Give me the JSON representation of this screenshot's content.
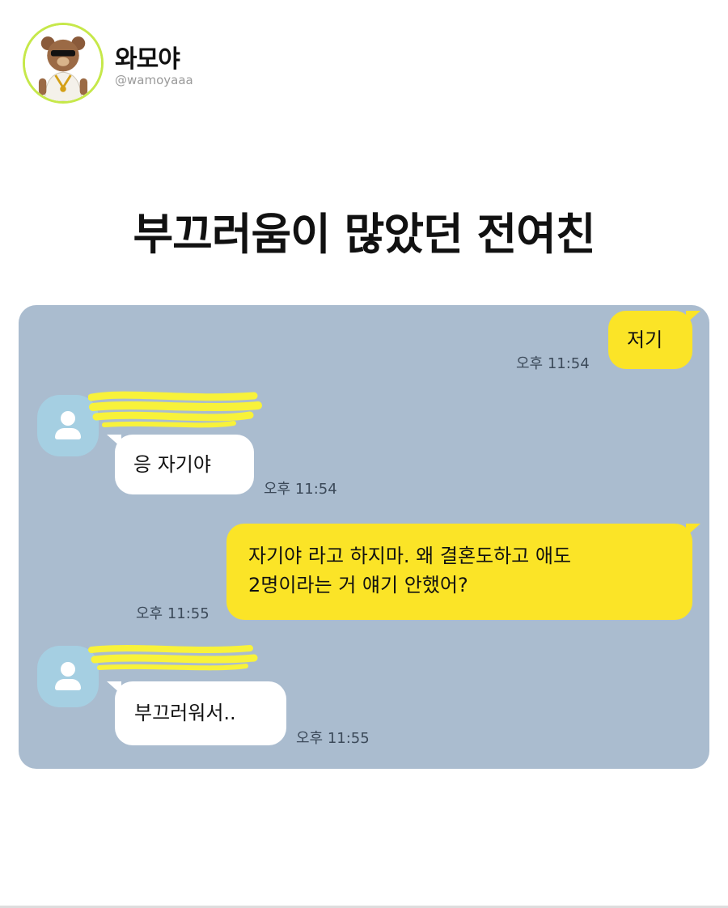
{
  "header": {
    "display_name": "와모야",
    "handle": "@wamoyaaa",
    "avatar_icon": "teddy-bear-avatar-icon",
    "avatar_ring_color": "#c6e84a"
  },
  "post": {
    "title": "부끄러움이 많았던 전여친"
  },
  "chat": {
    "background_color": "#aabccf",
    "sent_bubble_color": "#fbe427",
    "received_bubble_color": "#ffffff",
    "friend_avatar_icon": "default-profile-icon",
    "messages": [
      {
        "sender": "me",
        "text": "저기",
        "time": "오후 11:54"
      },
      {
        "sender": "friend",
        "text": "응 자기야",
        "time": "오후 11:54"
      },
      {
        "sender": "me",
        "text_line1": "자기야 라고 하지마. 왜 결혼도하고 애도",
        "text_line2": "2명이라는 거 얘기 안했어?",
        "time": "오후 11:55"
      },
      {
        "sender": "friend",
        "text": "부끄러워서..",
        "time": "오후 11:55"
      }
    ]
  }
}
